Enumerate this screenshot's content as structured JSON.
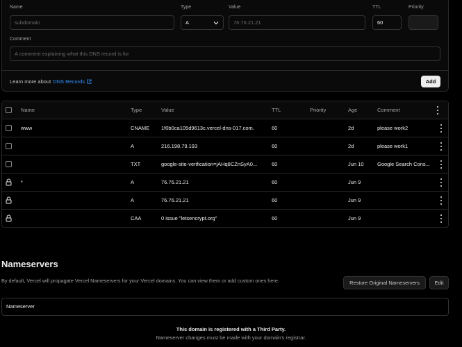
{
  "form": {
    "name_label": "Name",
    "name_placeholder": "subdomain",
    "type_label": "Type",
    "type_value": "A",
    "value_label": "Value",
    "value_placeholder": "76.76.21.21",
    "ttl_label": "TTL",
    "ttl_value": "60",
    "priority_label": "Priority",
    "priority_value": "",
    "comment_label": "Comment",
    "comment_placeholder": "A comment explaining what this DNS record is for",
    "learn_text": "Learn more about",
    "learn_link": "DNS Records",
    "add_button": "Add"
  },
  "table": {
    "headers": [
      "Name",
      "Type",
      "Value",
      "TTL",
      "Priority",
      "Age",
      "Comment"
    ],
    "rows": [
      {
        "lead": "checkbox",
        "name": "www",
        "type": "CNAME",
        "value": "1f0b0ca105d9613c.vercel-dns-017.com.",
        "ttl": "60",
        "priority": "",
        "age": "2d",
        "comment": "please work2"
      },
      {
        "lead": "checkbox",
        "name": "",
        "type": "A",
        "value": "216.198.79.193",
        "ttl": "60",
        "priority": "",
        "age": "2d",
        "comment": "please work1"
      },
      {
        "lead": "checkbox",
        "name": "",
        "type": "TXT",
        "value": "google-site-verification=jAHq8CZnSyA0...",
        "ttl": "60",
        "priority": "",
        "age": "Jun 10",
        "comment": "Google Search Cons..."
      },
      {
        "lead": "lock",
        "name": "*",
        "type": "A",
        "value": "76.76.21.21",
        "ttl": "60",
        "priority": "",
        "age": "Jun 9",
        "comment": ""
      },
      {
        "lead": "lock",
        "name": "",
        "type": "A",
        "value": "76.76.21.21",
        "ttl": "60",
        "priority": "",
        "age": "Jun 9",
        "comment": ""
      },
      {
        "lead": "lock",
        "name": "",
        "type": "CAA",
        "value": "0 issue \"letsencrypt.org\"",
        "ttl": "60",
        "priority": "",
        "age": "Jun 9",
        "comment": ""
      }
    ]
  },
  "nameservers": {
    "title": "Nameservers",
    "description": "By default, Vercel will propagate Vercel Nameservers for your Vercel domains. You can view them or add custom ones here.",
    "restore_button": "Restore Original Nameservers",
    "edit_button": "Edit",
    "input_placeholder": "Nameserver",
    "notice_title": "This domain is registered with a Third Party.",
    "notice_body": "Nameserver changes must be made with your domain's registrar."
  },
  "colors": {
    "background": "#000000",
    "link": "#3291ff",
    "border": "#2a2a2a"
  }
}
